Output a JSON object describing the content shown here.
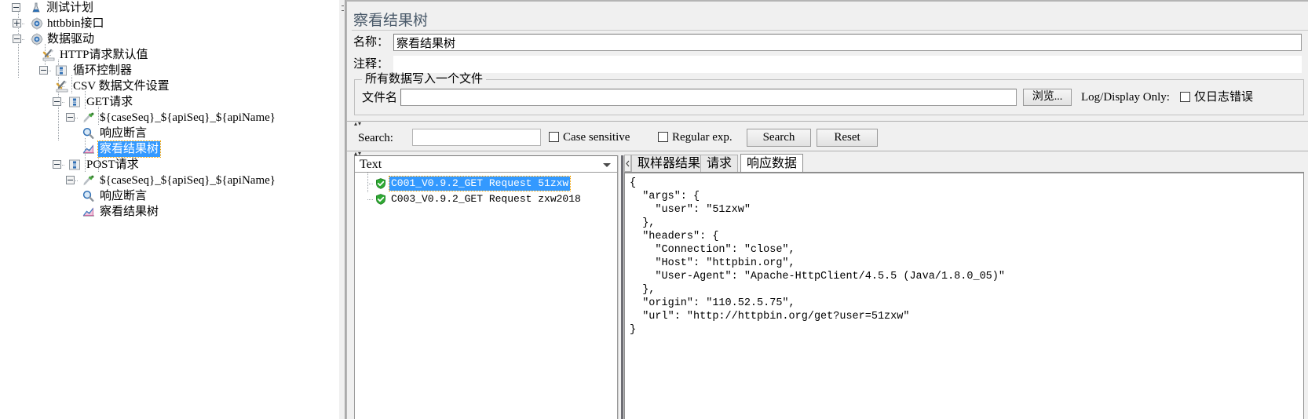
{
  "tree": {
    "nodes": [
      {
        "label": "测试计划",
        "icon": "test-plan-icon",
        "indent": 0,
        "toggle": "minus",
        "selected": false
      },
      {
        "label": "httbbin接口",
        "icon": "thread-group-icon",
        "indent": 1,
        "toggle": "plus",
        "selected": false
      },
      {
        "label": "数据驱动",
        "icon": "thread-group-icon",
        "indent": 1,
        "toggle": "minus",
        "selected": false
      },
      {
        "label": "HTTP请求默认值",
        "icon": "config-element-icon",
        "indent": 2,
        "toggle": "none",
        "selected": false
      },
      {
        "label": "循环控制器",
        "icon": "controller-icon",
        "indent": 2,
        "toggle": "minus",
        "selected": false
      },
      {
        "label": "CSV 数据文件设置",
        "icon": "config-element-icon",
        "indent": 3,
        "toggle": "none",
        "selected": false
      },
      {
        "label": "GET请求",
        "icon": "controller-icon",
        "indent": 3,
        "toggle": "minus",
        "selected": false
      },
      {
        "label": "${caseSeq}_${apiSeq}_${apiName}",
        "icon": "http-sampler-icon",
        "indent": 4,
        "toggle": "minus",
        "selected": false
      },
      {
        "label": "响应断言",
        "icon": "assertion-icon",
        "indent": 5,
        "toggle": "none",
        "selected": false
      },
      {
        "label": "察看结果树",
        "icon": "view-results-tree-icon",
        "indent": 5,
        "toggle": "none",
        "selected": true
      },
      {
        "label": "POST请求",
        "icon": "controller-icon",
        "indent": 3,
        "toggle": "minus",
        "selected": false
      },
      {
        "label": "${caseSeq}_${apiSeq}_${apiName}",
        "icon": "http-sampler-icon",
        "indent": 4,
        "toggle": "minus",
        "selected": false
      },
      {
        "label": "响应断言",
        "icon": "assertion-icon",
        "indent": 5,
        "toggle": "none",
        "selected": false
      },
      {
        "label": "察看结果树",
        "icon": "view-results-tree-icon",
        "indent": 5,
        "toggle": "none",
        "selected": false
      }
    ]
  },
  "panel": {
    "title": "察看结果树",
    "name_label": "名称：",
    "name_value": "察看结果树",
    "comment_label": "注释：",
    "comment_value": "",
    "filegroup": {
      "legend": "所有数据写入一个文件",
      "filename_label": "文件名",
      "filename_value": "",
      "browse_button": "浏览...",
      "log_display_label": "Log/Display Only:",
      "errors_only_label": "仅日志错误",
      "errors_only_checked": false
    },
    "search": {
      "label": "Search:",
      "value": "",
      "case_sensitive_label": "Case sensitive",
      "case_sensitive_checked": false,
      "regex_label": "Regular exp.",
      "regex_checked": false,
      "search_button": "Search",
      "reset_button": "Reset"
    },
    "renderer": {
      "selected": "Text"
    },
    "results": [
      {
        "label": "C001_V0.9.2_GET Request 51zxw",
        "status": "success",
        "selected": true
      },
      {
        "label": "C003_V0.9.2_GET Request zxw2018",
        "status": "success",
        "selected": false
      }
    ],
    "tabs": [
      {
        "label": "取样器结果",
        "active": false
      },
      {
        "label": "请求",
        "active": false
      },
      {
        "label": "响应数据",
        "active": true
      }
    ],
    "response_body": "{\n  \"args\": {\n    \"user\": \"51zxw\"\n  },\n  \"headers\": {\n    \"Connection\": \"close\",\n    \"Host\": \"httpbin.org\",\n    \"User-Agent\": \"Apache-HttpClient/4.5.5 (Java/1.8.0_05)\"\n  },\n  \"origin\": \"110.52.5.75\",\n  \"url\": \"http://httpbin.org/get?user=51zxw\"\n}"
  },
  "colors": {
    "selection": "#3399ff",
    "panel_bg": "#f0f0f0",
    "title_text": "#4a5a6a",
    "success_green": "#27a327"
  }
}
